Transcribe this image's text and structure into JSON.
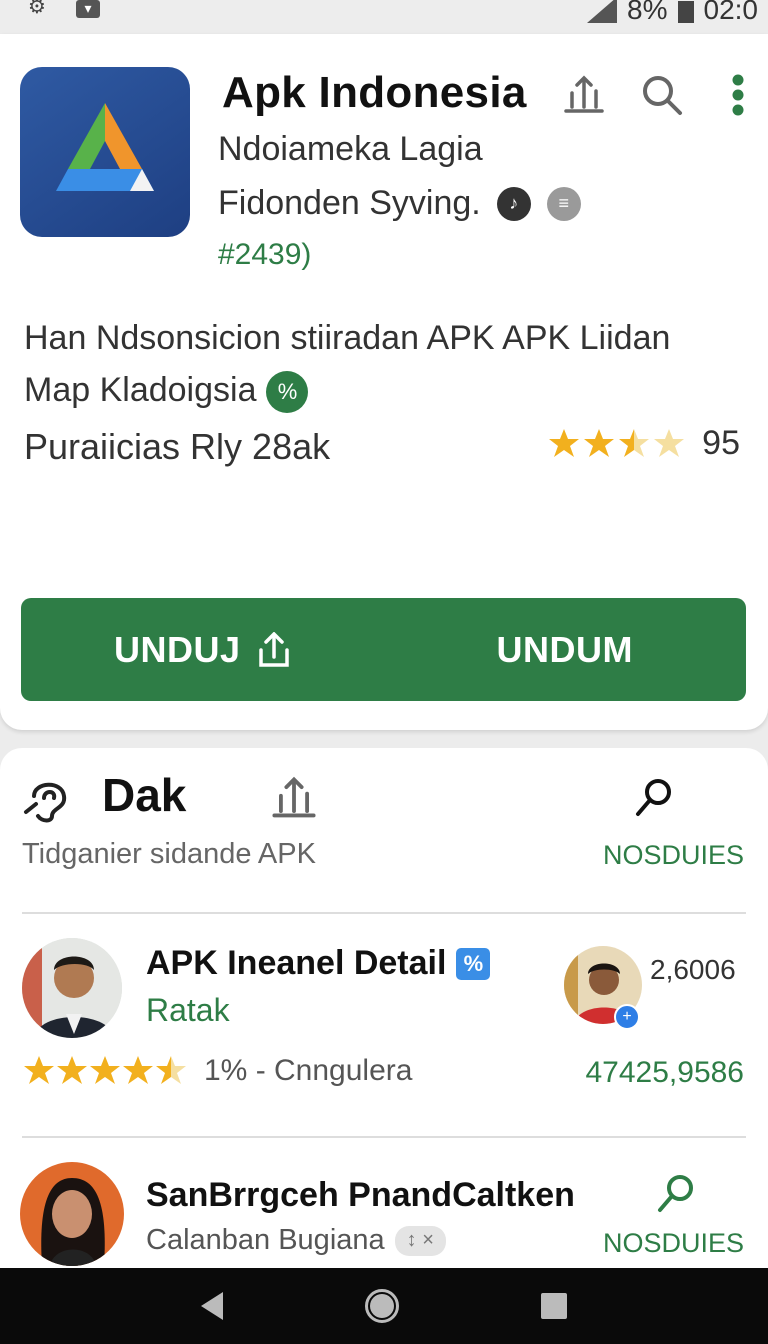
{
  "status_bar": {
    "battery": "8%",
    "time": "02:0"
  },
  "app": {
    "title": "Apk Indonesia",
    "subtitle": "Ndoiameka Lagia",
    "developer": "Fidonden Syving.",
    "count": "#2439)",
    "description": "Han Ndsonsicion stiiradan APK APK Liidan Map Kladoigsia",
    "purchases": "Puraiicias Rly 28ak",
    "rating_value": "95",
    "rating_stars": 3.5,
    "button_left": "UNDUJ",
    "button_right": "UNDUM"
  },
  "section": {
    "title": "Dak",
    "subtitle": "Tidganier sidande APK",
    "action": "NOSDUIES"
  },
  "rows": [
    {
      "name": "APK Ineanel Detail",
      "sub": "Ratak",
      "meta": "1% - Cnngulera",
      "count": "2,6006",
      "number": "47425,9586",
      "stars": 4.5
    },
    {
      "name": "SanBrrgceh PnandCaltken",
      "sub": "Calanban Bugiana",
      "action": "NOSDUIES"
    }
  ],
  "colors": {
    "accent": "#2e7d46",
    "icon_bg": "#2f5aa3"
  }
}
